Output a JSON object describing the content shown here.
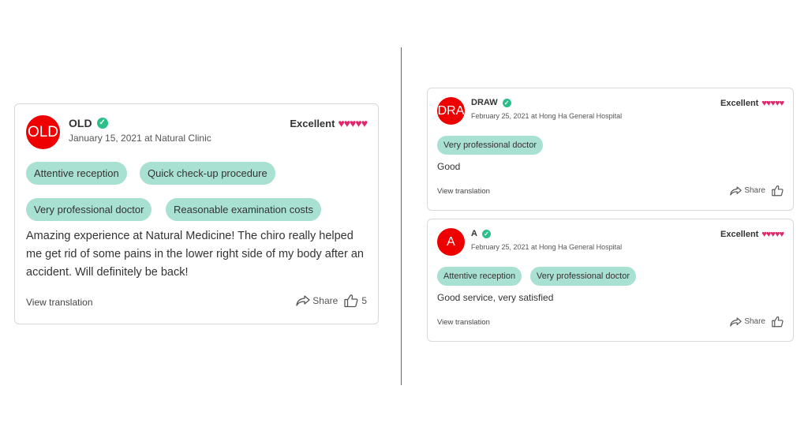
{
  "colors": {
    "avatar": "#ee0000",
    "tag": "#a8e0d2",
    "hearts": "#e3246b",
    "verified": "#2bbf8a"
  },
  "main_review": {
    "avatar_text": "OLD",
    "name": "OLD",
    "meta": "January 15, 2021 at Natural Clinic",
    "rating_label": "Excellent",
    "hearts": "♥♥♥♥♥",
    "tags": [
      "Attentive reception",
      "Quick check-up procedure",
      "Very professional doctor",
      "Reasonable examination costs"
    ],
    "text": "Amazing experience at Natural Medicine! The chiro really helped me get rid of some pains in the lower right side of my body after an accident. Will definitely be back!",
    "view_translation": "View translation",
    "share": "Share",
    "likes": "5"
  },
  "review_draw": {
    "avatar_text": "DRA",
    "name": "DRAW",
    "meta": "February 25, 2021 at Hong Ha General Hospital",
    "rating_label": "Excellent",
    "hearts": "♥♥♥♥♥",
    "tags": [
      "Very professional doctor"
    ],
    "text": "Good",
    "view_translation": "View translation",
    "share": "Share"
  },
  "review_a": {
    "avatar_text": "A",
    "name": "A",
    "meta": "February 25, 2021 at Hong Ha General Hospital",
    "rating_label": "Excellent",
    "hearts": "♥♥♥♥♥",
    "tags": [
      "Attentive reception",
      "Very professional doctor"
    ],
    "text": "Good service, very satisfied",
    "view_translation": "View translation",
    "share": "Share"
  }
}
